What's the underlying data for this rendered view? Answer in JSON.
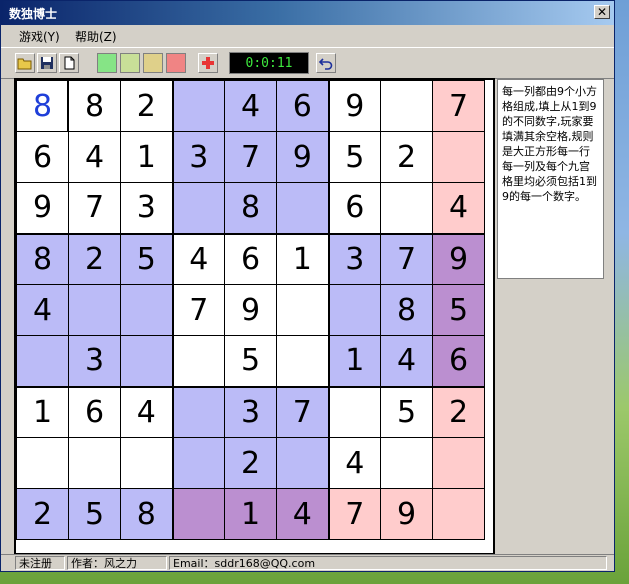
{
  "window": {
    "title": "数独博士",
    "close_glyph": "✕"
  },
  "menu": [
    {
      "label": "游戏(Y)"
    },
    {
      "label": "帮助(Z)"
    }
  ],
  "toolbar": {
    "buttons": [
      "open-folder-icon",
      "save-disk-icon",
      "new-document-icon"
    ],
    "swatches": [
      "#86e486",
      "#c8df98",
      "#dfd08a",
      "#f08484"
    ],
    "plus_icon": "red-cross-plus-icon",
    "timer": "0:0:11",
    "undo_icon": "undo-arrow-icon"
  },
  "colors": {
    "white": "#ffffff",
    "lavender": "#bbbbf7",
    "pink": "#ffcccc",
    "purple": "#bb8fd0",
    "given_text": "#000000",
    "entry_text": "#1f3fd9"
  },
  "board": {
    "rows": [
      [
        "8",
        "8",
        "2",
        "",
        "4",
        "6",
        "9",
        "",
        "7"
      ],
      [
        "6",
        "4",
        "1",
        "3",
        "7",
        "9",
        "5",
        "2",
        ""
      ],
      [
        "9",
        "7",
        "3",
        "",
        "8",
        "",
        "6",
        "",
        "4"
      ],
      [
        "8",
        "2",
        "5",
        "4",
        "6",
        "1",
        "3",
        "7",
        "9"
      ],
      [
        "4",
        "",
        "",
        "7",
        "9",
        "",
        "",
        "8",
        "5"
      ],
      [
        "",
        "3",
        "",
        "",
        "5",
        "",
        "1",
        "4",
        "6"
      ],
      [
        "1",
        "6",
        "4",
        "",
        "3",
        "7",
        "",
        "5",
        "2"
      ],
      [
        "",
        "",
        "",
        "",
        "2",
        "",
        "4",
        "",
        ""
      ],
      [
        "2",
        "5",
        "8",
        "",
        "1",
        "4",
        "7",
        "9",
        ""
      ]
    ],
    "fills": [
      [
        "w",
        "w",
        "w",
        "l",
        "l",
        "l",
        "w",
        "w",
        "p"
      ],
      [
        "w",
        "w",
        "w",
        "l",
        "l",
        "l",
        "w",
        "w",
        "p"
      ],
      [
        "w",
        "w",
        "w",
        "l",
        "l",
        "l",
        "w",
        "w",
        "p"
      ],
      [
        "l",
        "l",
        "l",
        "w",
        "w",
        "w",
        "l",
        "l",
        "u"
      ],
      [
        "l",
        "l",
        "l",
        "w",
        "w",
        "w",
        "l",
        "l",
        "u"
      ],
      [
        "l",
        "l",
        "l",
        "w",
        "w",
        "w",
        "l",
        "l",
        "u"
      ],
      [
        "w",
        "w",
        "w",
        "l",
        "l",
        "l",
        "w",
        "w",
        "p"
      ],
      [
        "w",
        "w",
        "w",
        "l",
        "l",
        "l",
        "w",
        "w",
        "p"
      ],
      [
        "l",
        "l",
        "l",
        "u",
        "u",
        "u",
        "p",
        "p",
        "p"
      ]
    ],
    "selected_cell": [
      0,
      0
    ]
  },
  "help_text": "每一列都由9个小方格组成,填上从1到9的不同数字,玩家要填满其余空格,规则是大正方形每一行每一列及每个九宫格里均必须包括1到9的每一个数字。",
  "status": {
    "registration": "未注册",
    "author": "作者：风之力",
    "email": "Email：sddr168@QQ.com"
  }
}
